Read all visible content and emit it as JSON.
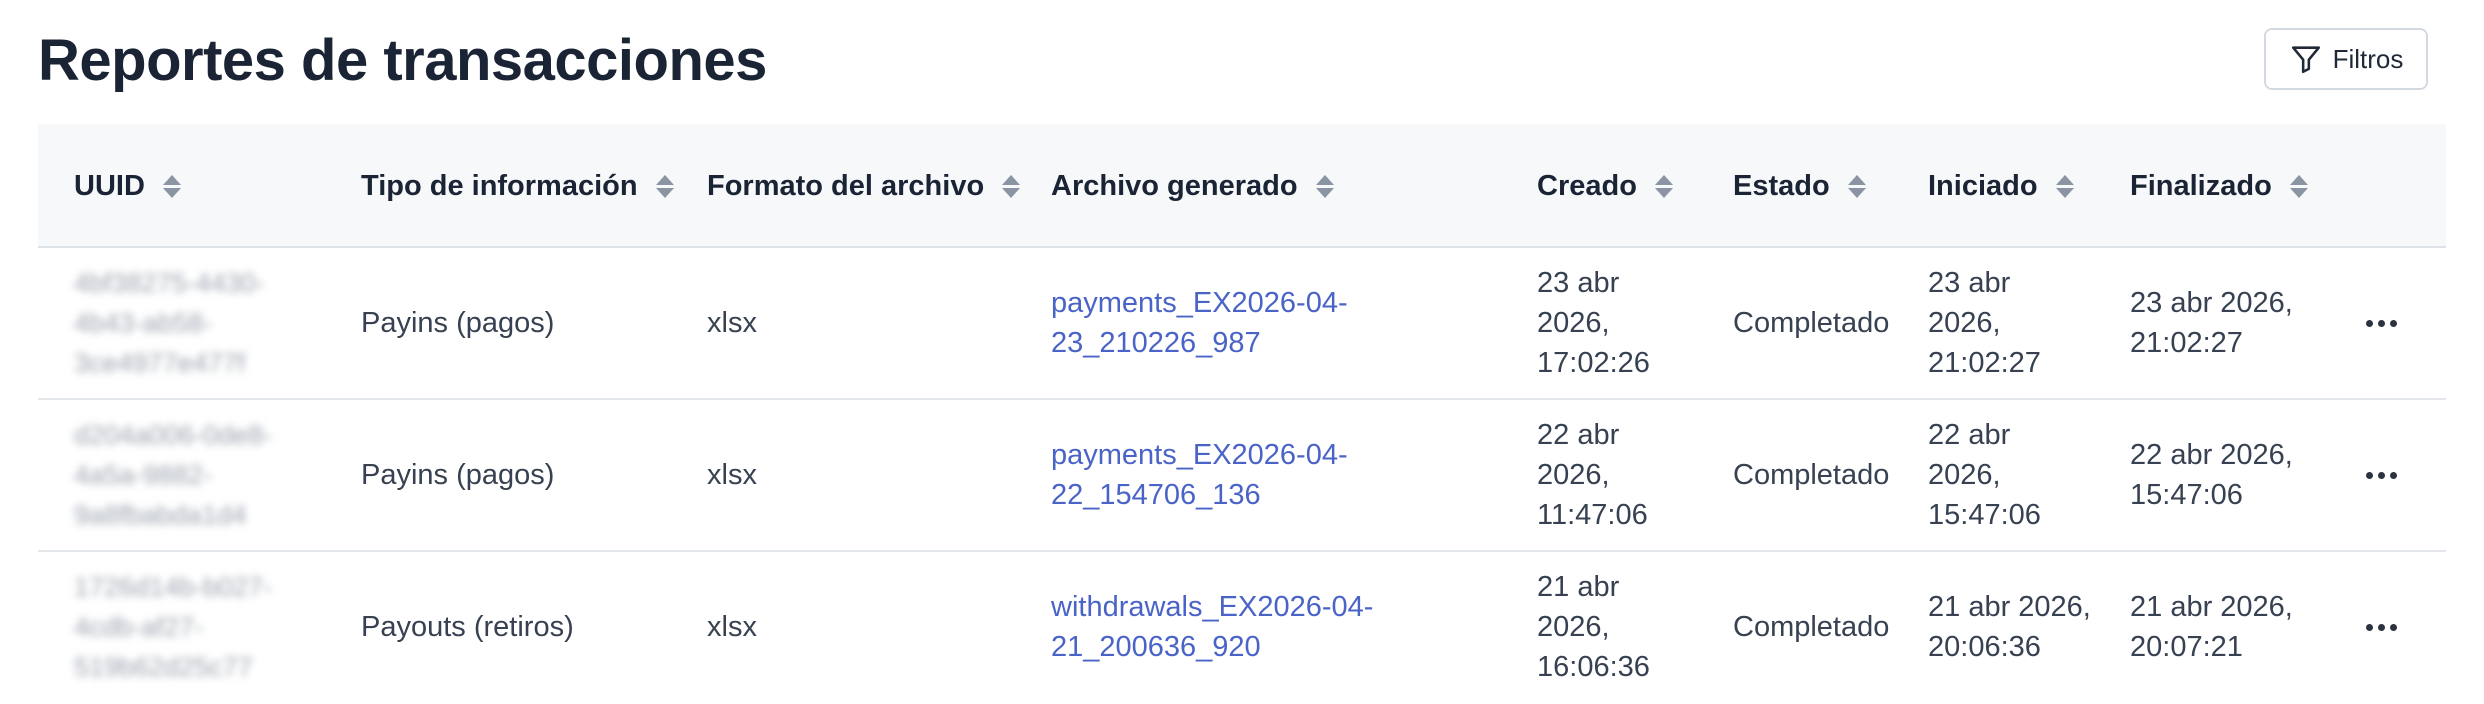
{
  "page": {
    "title": "Reportes de transacciones"
  },
  "toolbar": {
    "filter_label": "Filtros"
  },
  "table": {
    "columns": [
      "UUID",
      "Tipo de información",
      "Formato del archivo",
      "Archivo generado",
      "Creado",
      "Estado",
      "Iniciado",
      "Finalizado"
    ],
    "rows": [
      {
        "uuid": [
          "4bf38275-4430-",
          "4b43-ab58-",
          "3ce4977e477f"
        ],
        "type": "Payins (pagos)",
        "format": "xlsx",
        "file": [
          "payments_EX2026-04-",
          "23_210226_987"
        ],
        "created": [
          "23 abr",
          "2026,",
          "17:02:26"
        ],
        "status": "Completado",
        "started": [
          "23 abr",
          "2026,",
          "21:02:27"
        ],
        "finished": [
          "23 abr 2026,",
          "21:02:27"
        ]
      },
      {
        "uuid": [
          "d204a006-0de8-",
          "4a5a-9882-",
          "9a8fbabda1d4"
        ],
        "type": "Payins (pagos)",
        "format": "xlsx",
        "file": [
          "payments_EX2026-04-",
          "22_154706_136"
        ],
        "created": [
          "22 abr",
          "2026,",
          "11:47:06"
        ],
        "status": "Completado",
        "started": [
          "22 abr",
          "2026,",
          "15:47:06"
        ],
        "finished": [
          "22 abr 2026,",
          "15:47:06"
        ]
      },
      {
        "uuid": [
          "1726d14b-b027-",
          "4cdb-af27-",
          "519b62d25c77"
        ],
        "type": "Payouts (retiros)",
        "format": "xlsx",
        "file": [
          "withdrawals_EX2026-04-",
          "21_200636_920"
        ],
        "created": [
          "21 abr",
          "2026,",
          "16:06:36"
        ],
        "status": "Completado",
        "started": [
          "21 abr 2026,",
          "20:06:36"
        ],
        "finished": [
          "21 abr 2026,",
          "20:07:21"
        ]
      }
    ]
  }
}
